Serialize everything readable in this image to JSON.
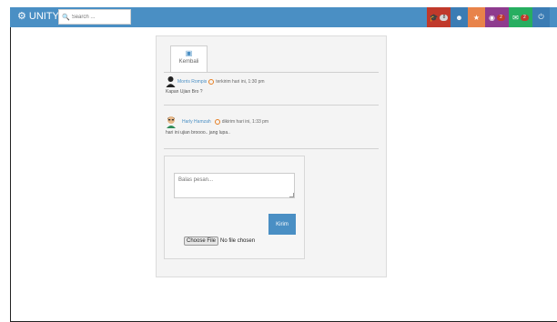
{
  "header": {
    "brand": "UNITY",
    "search_placeholder": "Search ...",
    "nav": [
      {
        "icon": "graduation-cap-icon",
        "badge": "8",
        "color": "#c0392b",
        "badge_style": "grey"
      },
      {
        "icon": "user-icon",
        "badge": "",
        "color": "#3b7cb4"
      },
      {
        "icon": "trophy-icon",
        "badge": "",
        "color": "#e8834a"
      },
      {
        "icon": "globe-icon",
        "badge": "2",
        "color": "#8e3b8e"
      },
      {
        "icon": "envelope-icon",
        "badge": "2",
        "color": "#27ae60"
      },
      {
        "icon": "power-icon",
        "badge": "",
        "color": "#3b7cb4"
      }
    ]
  },
  "conversation": {
    "back_label": "Kembali",
    "messages": [
      {
        "name": "Morris Rompis",
        "meta": "terkirim hari ini, 1:30 pm",
        "text": "Kapan Ujian Bro ?"
      },
      {
        "name": "Harly Hamzah",
        "meta": "dikirim hari ini, 1:33 pm",
        "text": "hari ini ujian broooo.. jang lupa.."
      }
    ],
    "reply_placeholder": "Balas pesan...",
    "send_label": "Kirim",
    "file_button": "Choose File",
    "file_status": "No file chosen"
  }
}
